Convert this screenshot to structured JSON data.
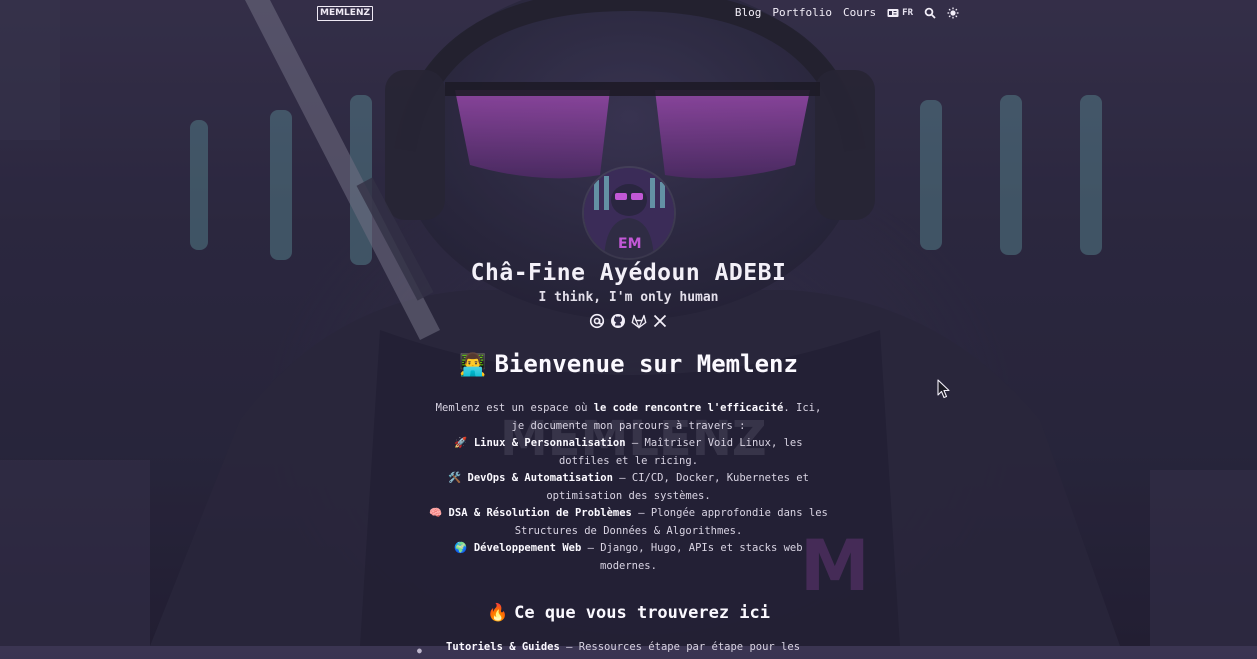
{
  "header": {
    "logo": "MEMLENZ",
    "nav": [
      {
        "label": "Blog"
      },
      {
        "label": "Portfolio"
      },
      {
        "label": "Cours"
      }
    ],
    "language": "FR"
  },
  "profile": {
    "name": "Châ-Fine Ayédoun ADEBI",
    "tagline": "I think, I'm only human",
    "socials": [
      "at-sign-icon",
      "github-icon",
      "gitlab-icon",
      "x-icon"
    ]
  },
  "welcome": {
    "emoji": "👨‍💻",
    "title": "Bienvenue sur Memlenz",
    "intro_prefix": "Memlenz est un espace où ",
    "intro_bold": "le code rencontre l'efficacité",
    "intro_suffix": ". Ici, je documente mon parcours à travers :",
    "topics": [
      {
        "emoji": "🚀",
        "bold": "Linux & Personnalisation",
        "text": " – Maîtriser Void Linux, les dotfiles et le ricing."
      },
      {
        "emoji": "🛠️",
        "bold": "DevOps & Automatisation",
        "text": " – CI/CD, Docker, Kubernetes et optimisation des systèmes."
      },
      {
        "emoji": "🧠",
        "bold": "DSA & Résolution de Problèmes",
        "text": " – Plongée approfondie dans les Structures de Données & Algorithmes."
      },
      {
        "emoji": "🌍",
        "bold": "Développement Web",
        "text": " – Django, Hugo, APIs et stacks web modernes."
      }
    ]
  },
  "section2": {
    "emoji": "🔥",
    "title": "Ce que vous trouverez ici",
    "items": [
      {
        "bold": "Tutoriels & Guides",
        "text": " – Ressources étape par étape pour les"
      }
    ]
  },
  "colors": {
    "background": "#2f2b45",
    "text": "#e6e2ef",
    "accent": "#c84fd8"
  }
}
